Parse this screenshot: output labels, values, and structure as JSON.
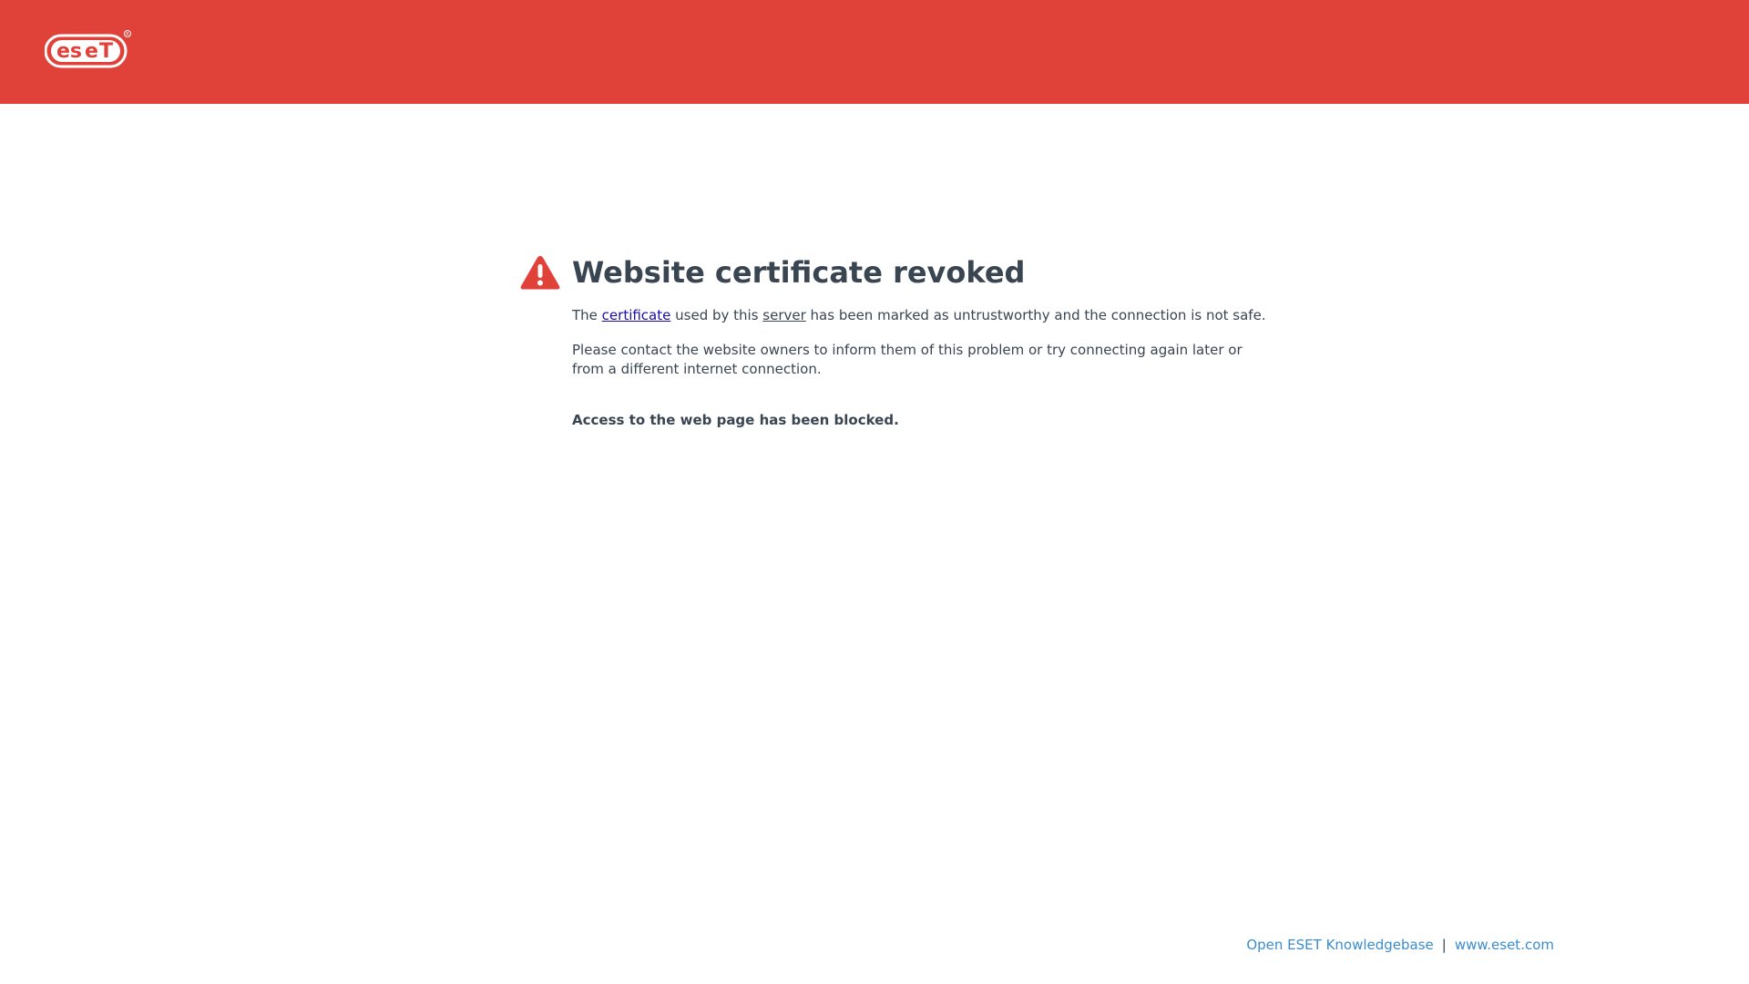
{
  "brand": {
    "logo_text": "eset",
    "header_color": "#e0423a"
  },
  "alert": {
    "icon": "warning-triangle-icon",
    "title": "Website certificate revoked",
    "line1_prefix": "The ",
    "line1_link_certificate": "certificate",
    "line1_mid": " used by this ",
    "line1_link_server": "server",
    "line1_suffix": " has been marked as untrustworthy and the connection is not safe.",
    "line2": "Please contact the website owners to inform them of this problem or try connecting again later or from a different internet connection.",
    "line3": "Access to the web page has been blocked."
  },
  "footer": {
    "knowledgebase_label": "Open ESET Knowledgebase",
    "separator": "|",
    "website_label": "www.eset.com"
  }
}
